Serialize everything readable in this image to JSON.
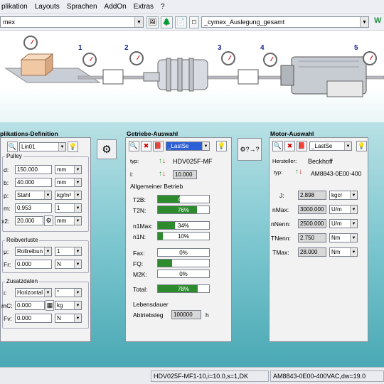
{
  "menu": [
    "plikation",
    "Layouts",
    "Sprachen",
    "AddOn",
    "Extras",
    "?"
  ],
  "toolbar": {
    "left_combo": "mex",
    "right_combo": "_cymex_Auslegung_gesamt",
    "brand": "W"
  },
  "drivetrain": {
    "labels": [
      "1",
      "2",
      "3",
      "4",
      "5"
    ]
  },
  "application": {
    "title": "plikations-Definition",
    "type_value": "Lin01",
    "group_pulley": "Pulley",
    "rows": [
      {
        "label": "d:",
        "value": "150.000",
        "unit": "mm"
      },
      {
        "label": "b:",
        "value": "40.000",
        "unit": "mm"
      },
      {
        "label": "p:",
        "value": "Stahl",
        "unit": "kg/m³"
      },
      {
        "label": "m:",
        "value": "0.953",
        "unit": "1"
      },
      {
        "label": "x2:",
        "value": "20.000",
        "unit": "mm"
      }
    ],
    "group_friction": "Reibverluste",
    "friction_rows": [
      {
        "label": "μ:",
        "value": "Rollreibun",
        "unit": "1"
      },
      {
        "label": "Fr:",
        "value": "0.000",
        "unit": "N"
      }
    ],
    "group_extra": "Zusatzdaten",
    "extra_rows": [
      {
        "label": "i:",
        "value": "Horizontal",
        "unit": "°"
      },
      {
        "label": "mC:",
        "value": "0.000",
        "unit": "kg"
      },
      {
        "label": "Fv:",
        "value": "0.000",
        "unit": "N"
      }
    ]
  },
  "gearbox": {
    "title": "Getriebe-Auswahl",
    "combo": "_LastSe",
    "typ_label": "typ:",
    "typ_value": "HDV025F-MF",
    "i_label": "i:",
    "i_value": "10.000",
    "section_general": "Allgemeiner Betrieb",
    "bars1": [
      {
        "label": "T2B:",
        "pct": 43,
        "text": "43%"
      },
      {
        "label": "T2N:",
        "pct": 76,
        "text": "76%"
      }
    ],
    "bars2": [
      {
        "label": "n1Max:",
        "pct": 34,
        "text": "34%"
      },
      {
        "label": "n1N:",
        "pct": 10,
        "text": "10%"
      }
    ],
    "bars3": [
      {
        "label": "Fax:",
        "pct": 0,
        "text": "0%"
      },
      {
        "label": "FQ:",
        "pct": 28,
        "text": "28%"
      },
      {
        "label": "M2K:",
        "pct": 0,
        "text": "0%"
      }
    ],
    "total_label": "Total:",
    "total_pct": 78,
    "total_text": "78%",
    "life_title": "Lebensdauer",
    "life_label": "Abtriebsleg",
    "life_value": "100000",
    "life_unit": "h"
  },
  "motor": {
    "title": "Motor-Auswahl",
    "combo": "_LastSe",
    "maker_label": "Hersteller:",
    "maker_value": "Beckhoff",
    "typ_label": "typ:",
    "typ_value": "AM8843-0E00-400",
    "rows": [
      {
        "label": "J:",
        "value": "2.898",
        "unit": "kgcr"
      },
      {
        "label": "nMax:",
        "value": "3000.000",
        "unit": "U/m"
      },
      {
        "label": "nNenn:",
        "value": "2500.000",
        "unit": "U/m"
      },
      {
        "label": "TNenn:",
        "value": "2.750",
        "unit": "Nm"
      },
      {
        "label": "TMax:",
        "value": "28.000",
        "unit": "Nm"
      }
    ]
  },
  "status": {
    "left": "HDV025F-MF1-10,i=10.0,s=1,DK",
    "right": "AM8843-0E00-400VAC,dw=19.0"
  }
}
